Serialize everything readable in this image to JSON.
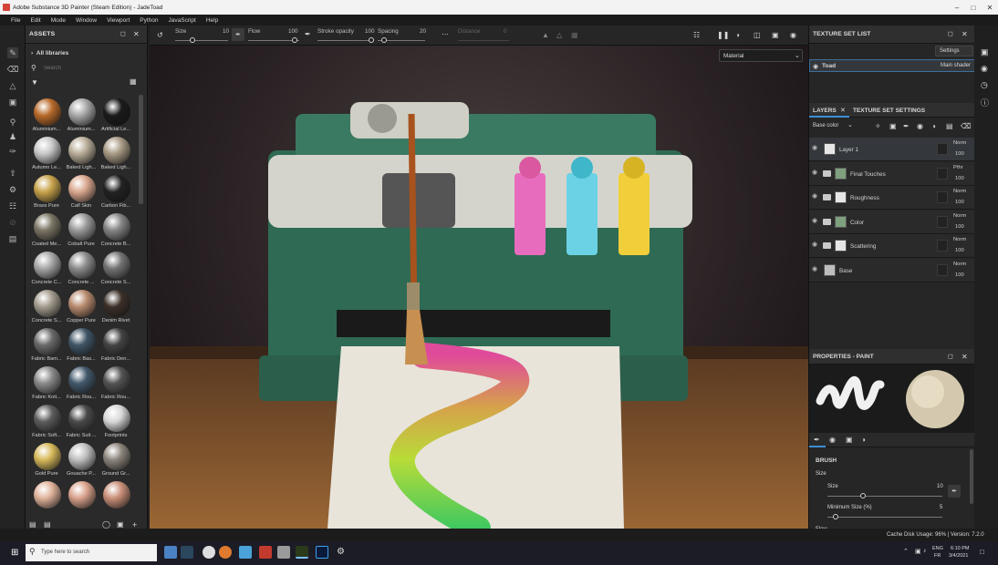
{
  "window": {
    "title": "Adobe Substance 3D Painter (Steam Edition) - JadeToad"
  },
  "menu": [
    "File",
    "Edit",
    "Mode",
    "Window",
    "Viewport",
    "Python",
    "JavaScript",
    "Help"
  ],
  "toolbar": {
    "size_label": "Size",
    "size_value": "10",
    "flow_label": "Flow",
    "flow_value": "100",
    "stroke_opacity_label": "Stroke opacity",
    "stroke_opacity_value": "100",
    "spacing_label": "Spacing",
    "spacing_value": "20",
    "distance_label": "Distance",
    "distance_value": "0"
  },
  "assets": {
    "header": "ASSETS",
    "library": "All libraries",
    "search_placeholder": "Search",
    "items": [
      {
        "label": "Aluminium...",
        "color": "#b86a2a"
      },
      {
        "label": "Aluminium...",
        "color": "#a8a8a8"
      },
      {
        "label": "Artificial Le...",
        "color": "#1a1a1a"
      },
      {
        "label": "Autumn Le...",
        "color": "#c8c8c8"
      },
      {
        "label": "Baked Ligh...",
        "color": "#b9ad98"
      },
      {
        "label": "Baked Ligh...",
        "color": "#a89a84"
      },
      {
        "label": "Brass Pure",
        "color": "#c7a24a"
      },
      {
        "label": "Calf Skin",
        "color": "#d9a78e"
      },
      {
        "label": "Carbon Fib...",
        "color": "#222222"
      },
      {
        "label": "Coated Me...",
        "color": "#7b7565"
      },
      {
        "label": "Cobalt Pure",
        "color": "#9a9a9a"
      },
      {
        "label": "Concrete B...",
        "color": "#858585"
      },
      {
        "label": "Concrete C...",
        "color": "#a7a7a7"
      },
      {
        "label": "Concrete ...",
        "color": "#8c8c8c"
      },
      {
        "label": "Concrete S...",
        "color": "#737373"
      },
      {
        "label": "Concrete S...",
        "color": "#a39b8d"
      },
      {
        "label": "Copper Pure",
        "color": "#b88a6e"
      },
      {
        "label": "Denim Rivet",
        "color": "#3c3029"
      },
      {
        "label": "Fabric Bam...",
        "color": "#6a6a6a"
      },
      {
        "label": "Fabric Bas...",
        "color": "#3f5566"
      },
      {
        "label": "Fabric Den...",
        "color": "#444444"
      },
      {
        "label": "Fabric Knit...",
        "color": "#8a8a8a"
      },
      {
        "label": "Fabric Rou...",
        "color": "#42586b"
      },
      {
        "label": "Fabric Rou...",
        "color": "#545454"
      },
      {
        "label": "Fabric Soft...",
        "color": "#5c5c5c"
      },
      {
        "label": "Fabric Suit ...",
        "color": "#4a4a4a"
      },
      {
        "label": "Footprints",
        "color": "#d8d8d8"
      },
      {
        "label": "Gold Pure",
        "color": "#d6b85a"
      },
      {
        "label": "Gouache P...",
        "color": "#bfbfbf"
      },
      {
        "label": "Ground Gr...",
        "color": "#8c857c"
      },
      {
        "label": "",
        "color": "#e0b39b"
      },
      {
        "label": "",
        "color": "#d9a28c"
      },
      {
        "label": "",
        "color": "#c98f78"
      }
    ]
  },
  "viewport": {
    "mode_select": "Material"
  },
  "texture_set_list": {
    "header": "TEXTURE SET LIST",
    "settings_label": "Settings",
    "item": "Toad",
    "shader": "Main shader"
  },
  "layers": {
    "tab": "LAYERS",
    "tab2": "TEXTURE SET SETTINGS",
    "channel": "Base color",
    "rows": [
      {
        "name": "Layer 1",
        "blend": "Norm",
        "opacity": "100",
        "thumb": "#e6e6e6",
        "folder": false
      },
      {
        "name": "Final Touches",
        "blend": "Pthr",
        "opacity": "100",
        "thumb": "#7ea07e",
        "folder": true
      },
      {
        "name": "Roughness",
        "blend": "Norm",
        "opacity": "100",
        "thumb": "#e6e6e6",
        "folder": true
      },
      {
        "name": "Color",
        "blend": "Norm",
        "opacity": "100",
        "thumb": "#7ea07e",
        "folder": true
      },
      {
        "name": "Scattering",
        "blend": "Norm",
        "opacity": "100",
        "thumb": "#e6e6e6",
        "folder": true
      },
      {
        "name": "Base",
        "blend": "Norm",
        "opacity": "100",
        "thumb": "#bdbdbd",
        "folder": false
      }
    ]
  },
  "properties": {
    "header": "PROPERTIES - PAINT",
    "section": "BRUSH",
    "size_group": "Size",
    "size_label": "Size",
    "size_value": "10",
    "min_size_label": "Minimum Size (%)",
    "min_size_value": "5",
    "flow_label": "Flow"
  },
  "status": {
    "text": "Cache Disk Usage: 96% | Version: 7.2.0"
  },
  "taskbar": {
    "search_placeholder": "Type here to search",
    "lang_top": "ENG",
    "lang_bottom": "FR",
    "time": "6:10 PM",
    "date": "3/4/2021"
  }
}
